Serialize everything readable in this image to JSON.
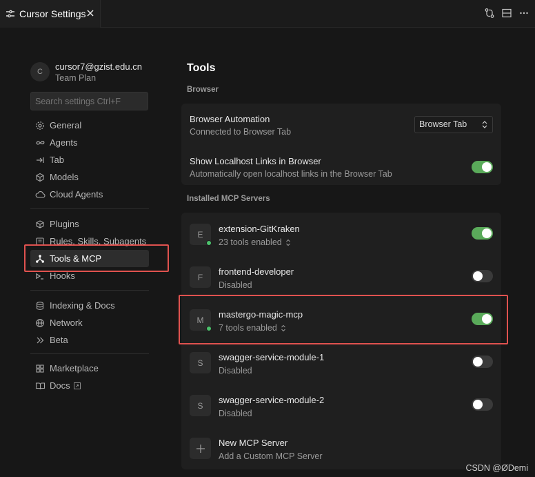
{
  "tab": {
    "title": "Cursor Settings"
  },
  "user": {
    "avatar_letter": "C",
    "email": "cursor7@gzist.edu.cn",
    "plan": "Team Plan"
  },
  "search": {
    "placeholder": "Search settings Ctrl+F"
  },
  "nav": {
    "group1": [
      {
        "label": "General",
        "icon": "gear-icon"
      },
      {
        "label": "Agents",
        "icon": "infinity-icon"
      },
      {
        "label": "Tab",
        "icon": "tab-arrow-icon"
      },
      {
        "label": "Models",
        "icon": "cube-icon"
      },
      {
        "label": "Cloud Agents",
        "icon": "cloud-icon"
      }
    ],
    "group2": [
      {
        "label": "Plugins",
        "icon": "plugin-icon"
      },
      {
        "label": "Rules, Skills, Subagents",
        "icon": "rules-icon"
      },
      {
        "label": "Tools & MCP",
        "icon": "tools-icon",
        "active": true
      },
      {
        "label": "Hooks",
        "icon": "hooks-icon"
      }
    ],
    "group3": [
      {
        "label": "Indexing & Docs",
        "icon": "database-icon"
      },
      {
        "label": "Network",
        "icon": "globe-icon"
      },
      {
        "label": "Beta",
        "icon": "chevrons-right-icon"
      }
    ],
    "group4": [
      {
        "label": "Marketplace",
        "icon": "marketplace-icon"
      },
      {
        "label": "Docs",
        "icon": "book-icon",
        "external": true
      }
    ]
  },
  "content": {
    "title": "Tools",
    "browser_section": "Browser",
    "browser_automation": {
      "title": "Browser Automation",
      "subtitle": "Connected to Browser Tab",
      "select_value": "Browser Tab"
    },
    "localhost_links": {
      "title": "Show Localhost Links in Browser",
      "subtitle": "Automatically open localhost links in the Browser Tab",
      "enabled": true
    },
    "mcp_section": "Installed MCP Servers",
    "servers": [
      {
        "letter": "E",
        "name": "extension-GitKraken",
        "status": "23 tools enabled",
        "enabled": true,
        "online": true
      },
      {
        "letter": "F",
        "name": "frontend-developer",
        "status": "Disabled",
        "enabled": false,
        "online": false
      },
      {
        "letter": "M",
        "name": "mastergo-magic-mcp",
        "status": "7 tools enabled",
        "enabled": true,
        "online": true
      },
      {
        "letter": "S",
        "name": "swagger-service-module-1",
        "status": "Disabled",
        "enabled": false,
        "online": false
      },
      {
        "letter": "S",
        "name": "swagger-service-module-2",
        "status": "Disabled",
        "enabled": false,
        "online": false
      }
    ],
    "new_server": {
      "title": "New MCP Server",
      "subtitle": "Add a Custom MCP Server"
    }
  },
  "watermark": "CSDN @ØDemi",
  "colors": {
    "toggle_on": "#5aaa5a",
    "highlight": "#e0524f",
    "online_dot": "#4cc26c"
  }
}
